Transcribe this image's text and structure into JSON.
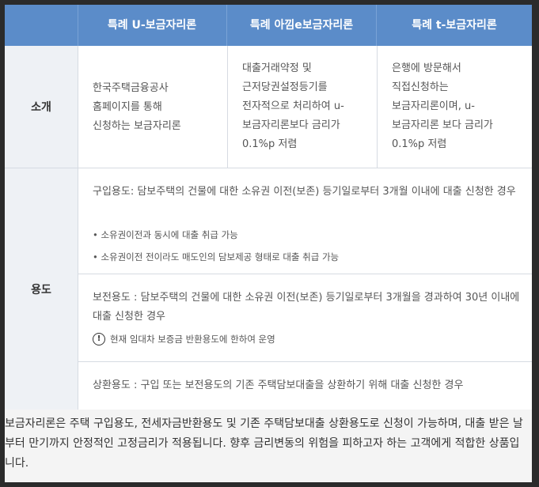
{
  "table": {
    "columns": [
      "특례 U-보금자리론",
      "특례 아낌e보금자리론",
      "특례 t-보금자리론"
    ],
    "intro": {
      "label": "소개",
      "cells": [
        "한국주택금융공사\n홈페이지를 통해\n신청하는 보금자리론",
        "대출거래약정 및\n근저당권설정등기를\n전자적으로 처리하여 u-\n보금자리론보다 금리가\n0.1%p 저렴",
        "은행에 방문해서\n직접신청하는\n보금자리론이며, u-\n보금자리론 보다 금리가\n0.1%p 저렴"
      ]
    },
    "usage": {
      "label": "용도",
      "purchase": {
        "text": "구입용도: 담보주택의 건물에 대한 소유권 이전(보존) 등기일로부터 3개월 이내에 대출 신청한 경우",
        "bullets": [
          "• 소유권이전과 동시에 대출 취급 가능",
          "• 소유권이전 전이라도 매도인의 담보제공 형태로 대출 취급 가능"
        ]
      },
      "preserve": {
        "text": "보전용도 : 담보주택의 건물에 대한 소유권 이전(보존) 등기일로부터 3개월을 경과하여 30년 이내에 대출 신청한 경우",
        "note": "현재 임대차 보증금 반환용도에 한하여 운영",
        "note_icon": "!"
      },
      "repay": {
        "text": "상환용도 : 구입 또는 보전용도의 기존 주택담보대출을 상환하기 위해 대출 신청한 경우"
      }
    }
  },
  "footer": {
    "text": "보금자리론은 주택 구입용도, 전세자금반환용도 및 기존 주택담보대출 상환용도로 신청이 가능하며, 대출 받은 날부터 만기까지 안정적인 고정금리가 적용됩니다. 향후 금리변동의 위험을 피하고자 하는 고객에게 적합한 상품입니다."
  },
  "colors": {
    "header_bg": "#5b8cc9",
    "rowhead_bg": "#eef1f5"
  }
}
